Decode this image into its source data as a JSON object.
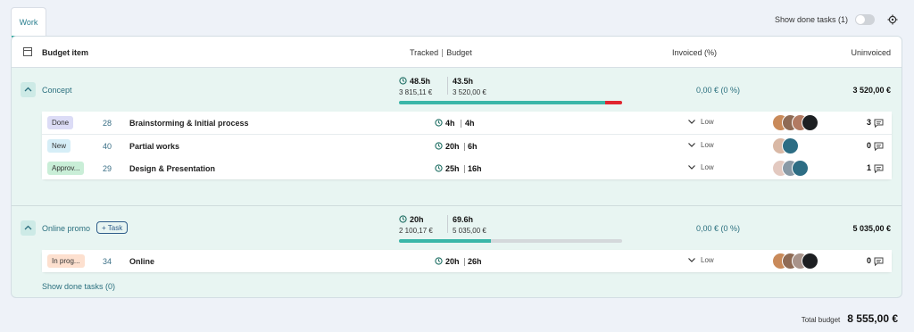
{
  "tabs": [
    {
      "label": "Work"
    }
  ],
  "toolbar": {
    "show_done_label": "Show done tasks (1)"
  },
  "table": {
    "headers": {
      "budget_item": "Budget item",
      "tracked": "Tracked",
      "budget": "Budget",
      "invoiced": "Invoiced (%)",
      "uninvoiced": "Uninvoiced"
    }
  },
  "groups": [
    {
      "name": "Concept",
      "tracked_hours": "48.5h",
      "tracked_money": "3 815,11 €",
      "budget_hours": "43.5h",
      "budget_money": "3 520,00 €",
      "progress": 0.925,
      "overrun": 0.075,
      "invoiced": "0,00 € (0 %)",
      "uninvoiced": "3 520,00 €",
      "tasks": [
        {
          "status": "Done",
          "status_color": "#dcdcf6",
          "id": "28",
          "name": "Brainstorming & Initial process",
          "tracked": "4h",
          "budget": "4h",
          "priority": "Low",
          "comments": "3"
        },
        {
          "status": "New",
          "status_color": "#d6eef7",
          "id": "40",
          "name": "Partial works",
          "tracked": "20h",
          "budget": "6h",
          "priority": "Low",
          "comments": "0"
        },
        {
          "status": "Approv...",
          "status_color": "#c9eed7",
          "id": "29",
          "name": "Design & Presentation",
          "tracked": "25h",
          "budget": "16h",
          "priority": "Low",
          "comments": "1"
        }
      ]
    },
    {
      "name": "Online promo",
      "add_task_label": "Task",
      "tracked_hours": "20h",
      "tracked_money": "2 100,17 €",
      "budget_hours": "69.6h",
      "budget_money": "5 035,00 €",
      "progress": 0.41,
      "invoiced": "0,00 € (0 %)",
      "uninvoiced": "5 035,00 €",
      "tasks": [
        {
          "status": "In prog...",
          "status_color": "#fde0cf",
          "id": "34",
          "name": "Online",
          "tracked": "20h",
          "budget": "26h",
          "priority": "Low",
          "comments": "0"
        }
      ],
      "show_done_label": "Show done tasks (0)"
    }
  ],
  "footer": {
    "total_label": "Total budget",
    "total_value": "8 555,00 €"
  },
  "colors": {
    "accent": "#3ab6a8",
    "overrun": "#e0252f",
    "link": "#2a6f7e"
  }
}
